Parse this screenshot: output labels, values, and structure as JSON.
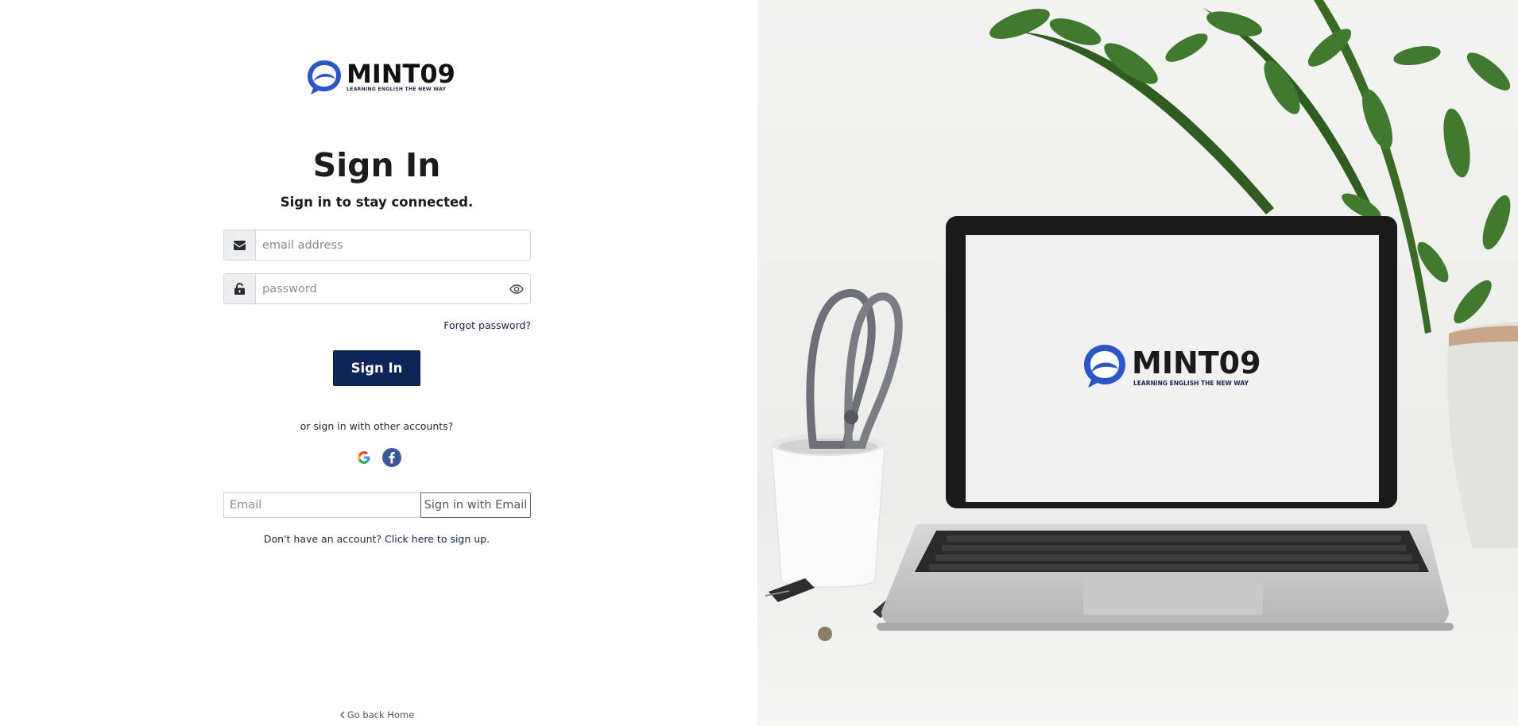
{
  "brand": {
    "name": "MINT09",
    "tagline": "LEARNING ENGLISH THE NEW WAY",
    "primary_color": "#0f2557",
    "logo_blue": "#2a56c6"
  },
  "heading": {
    "title": "Sign In",
    "subtitle": "Sign in to stay connected."
  },
  "form": {
    "email_placeholder": "email address",
    "email_icon": "envelope-icon",
    "password_placeholder": "password",
    "password_icon": "lock-icon",
    "toggle_icon": "eye-icon",
    "forgot_label": "Forgot password?",
    "submit_label": "Sign In"
  },
  "social": {
    "prompt": "or sign in with other accounts?",
    "providers": [
      "google-icon",
      "facebook-icon"
    ]
  },
  "magic_link": {
    "placeholder": "Email",
    "button_label": "Sign in with Email"
  },
  "signup": {
    "prompt": "Don't have an account?",
    "link_label": "Click here to sign up."
  },
  "footer": {
    "back_label": "Go back Home"
  },
  "hero": {
    "screen_brand": "MINT09",
    "screen_tagline": "LEARNING ENGLISH THE NEW WAY"
  }
}
